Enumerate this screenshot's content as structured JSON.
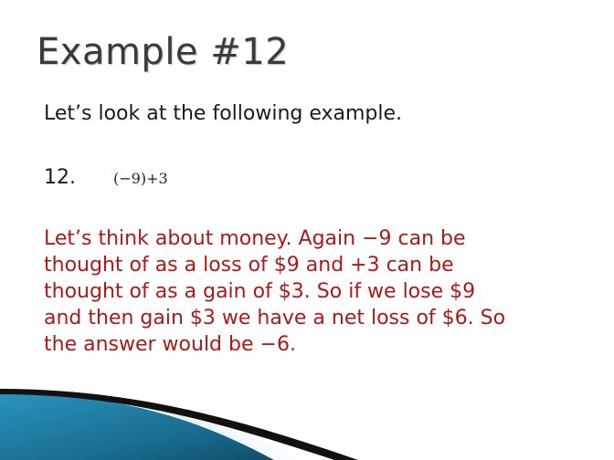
{
  "slide": {
    "title": "Example #12",
    "intro": "Let’s look at the following example.",
    "problem_number": "12.",
    "expression": "(−9)+3",
    "explanation_lines": [
      "Let’s think about money.  Again −9 can be",
      "thought of as a loss of $9 and +3 can be",
      "thought of as a gain of $3.  So if we lose $9",
      "and then gain $3 we have a net loss of $6.  So",
      "the answer would be −6."
    ]
  },
  "colors": {
    "title": "#3a3a3a",
    "body": "#1a1a1a",
    "accent_red": "#b01818",
    "swoosh_teal": "#1e7fa6",
    "swoosh_dark": "#111111"
  }
}
